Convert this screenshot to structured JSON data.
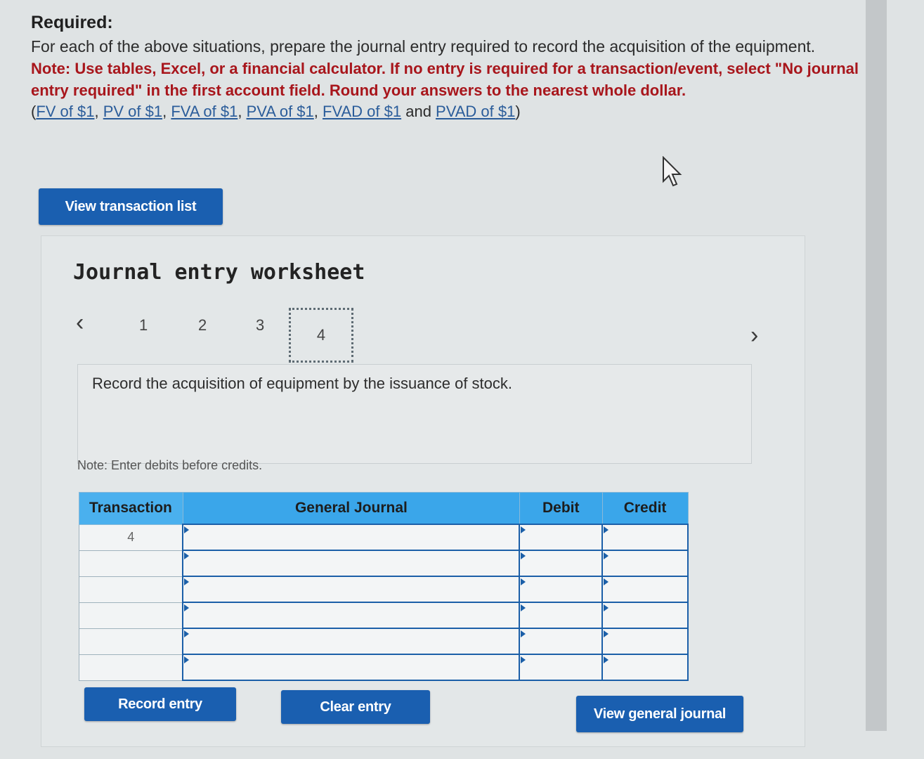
{
  "required": {
    "title": "Required:",
    "instruction": "For each of the above situations, prepare the journal entry required to record the acquisition of the equipment.",
    "note": "Note: Use tables, Excel, or a financial calculator. If no entry is required for a transaction/event, select \"No journal entry required\" in the first account field. Round your answers to the nearest whole dollar.",
    "links": [
      "FV of $1",
      "PV of $1",
      "FVA of $1",
      "PVA of $1",
      "FVAD of $1",
      "PVAD of $1"
    ],
    "links_open": "(",
    "links_sep": ", ",
    "links_and": " and ",
    "links_close": ")"
  },
  "buttons": {
    "view_transaction_list": "View transaction list",
    "record_entry": "Record entry",
    "clear_entry": "Clear entry",
    "view_general_journal": "View general journal"
  },
  "worksheet": {
    "title": "Journal entry worksheet",
    "pages": [
      "1",
      "2",
      "3",
      "4"
    ],
    "current_page": "4",
    "description": "Record the acquisition of equipment by the issuance of stock.",
    "note": "Note: Enter debits before credits."
  },
  "table": {
    "headers": [
      "Transaction",
      "General Journal",
      "Debit",
      "Credit"
    ],
    "rows": [
      {
        "transaction": "4",
        "account": "",
        "debit": "",
        "credit": ""
      },
      {
        "transaction": "",
        "account": "",
        "debit": "",
        "credit": ""
      },
      {
        "transaction": "",
        "account": "",
        "debit": "",
        "credit": ""
      },
      {
        "transaction": "",
        "account": "",
        "debit": "",
        "credit": ""
      },
      {
        "transaction": "",
        "account": "",
        "debit": "",
        "credit": ""
      },
      {
        "transaction": "",
        "account": "",
        "debit": "",
        "credit": ""
      }
    ]
  },
  "colors": {
    "accent": "#1a5fb0",
    "header_blue": "#3aa6ea",
    "note_red": "#a8161c"
  }
}
